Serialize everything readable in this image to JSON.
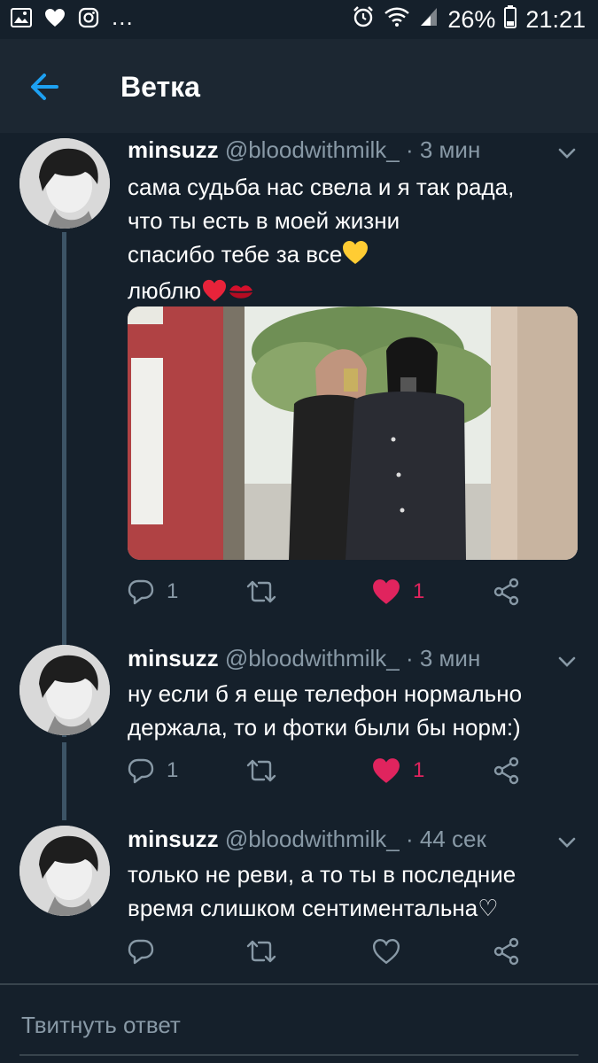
{
  "status_bar": {
    "more": "...",
    "battery": "26%",
    "time": "21:21"
  },
  "header": {
    "title": "Ветка"
  },
  "tweets": [
    {
      "name": "minsuzz",
      "handle": "@bloodwithmilk_",
      "separator": "·",
      "time": "3 мин",
      "lines": [
        "сама судьба нас свела и я так рада,",
        "что ты есть в моей жизни",
        "спасибо тебе за все",
        "люблю"
      ],
      "emoji": [
        "yellow-heart",
        "red-heart",
        "kiss-mark"
      ],
      "has_media": true,
      "replies": "1",
      "likes": "1",
      "liked": true
    },
    {
      "name": "minsuzz",
      "handle": "@bloodwithmilk_",
      "separator": "·",
      "time": "3 мин",
      "lines": [
        "ну если б я еще телефон нормально",
        "держала, то и фотки были бы норм:)"
      ],
      "replies": "1",
      "likes": "1",
      "liked": true
    },
    {
      "name": "minsuzz",
      "handle": "@bloodwithmilk_",
      "separator": "·",
      "time": "44 сек",
      "lines": [
        "только не реви, а то ты в последние",
        "время слишком сентиментальна♡"
      ],
      "replies": "",
      "likes": "",
      "liked": false
    }
  ],
  "reply_bar": {
    "placeholder": "Твитнуть ответ"
  },
  "colors": {
    "background": "#15202b",
    "header": "#1c2732",
    "accent": "#1da1f2",
    "like": "#e0245e",
    "muted": "#8899a6"
  }
}
